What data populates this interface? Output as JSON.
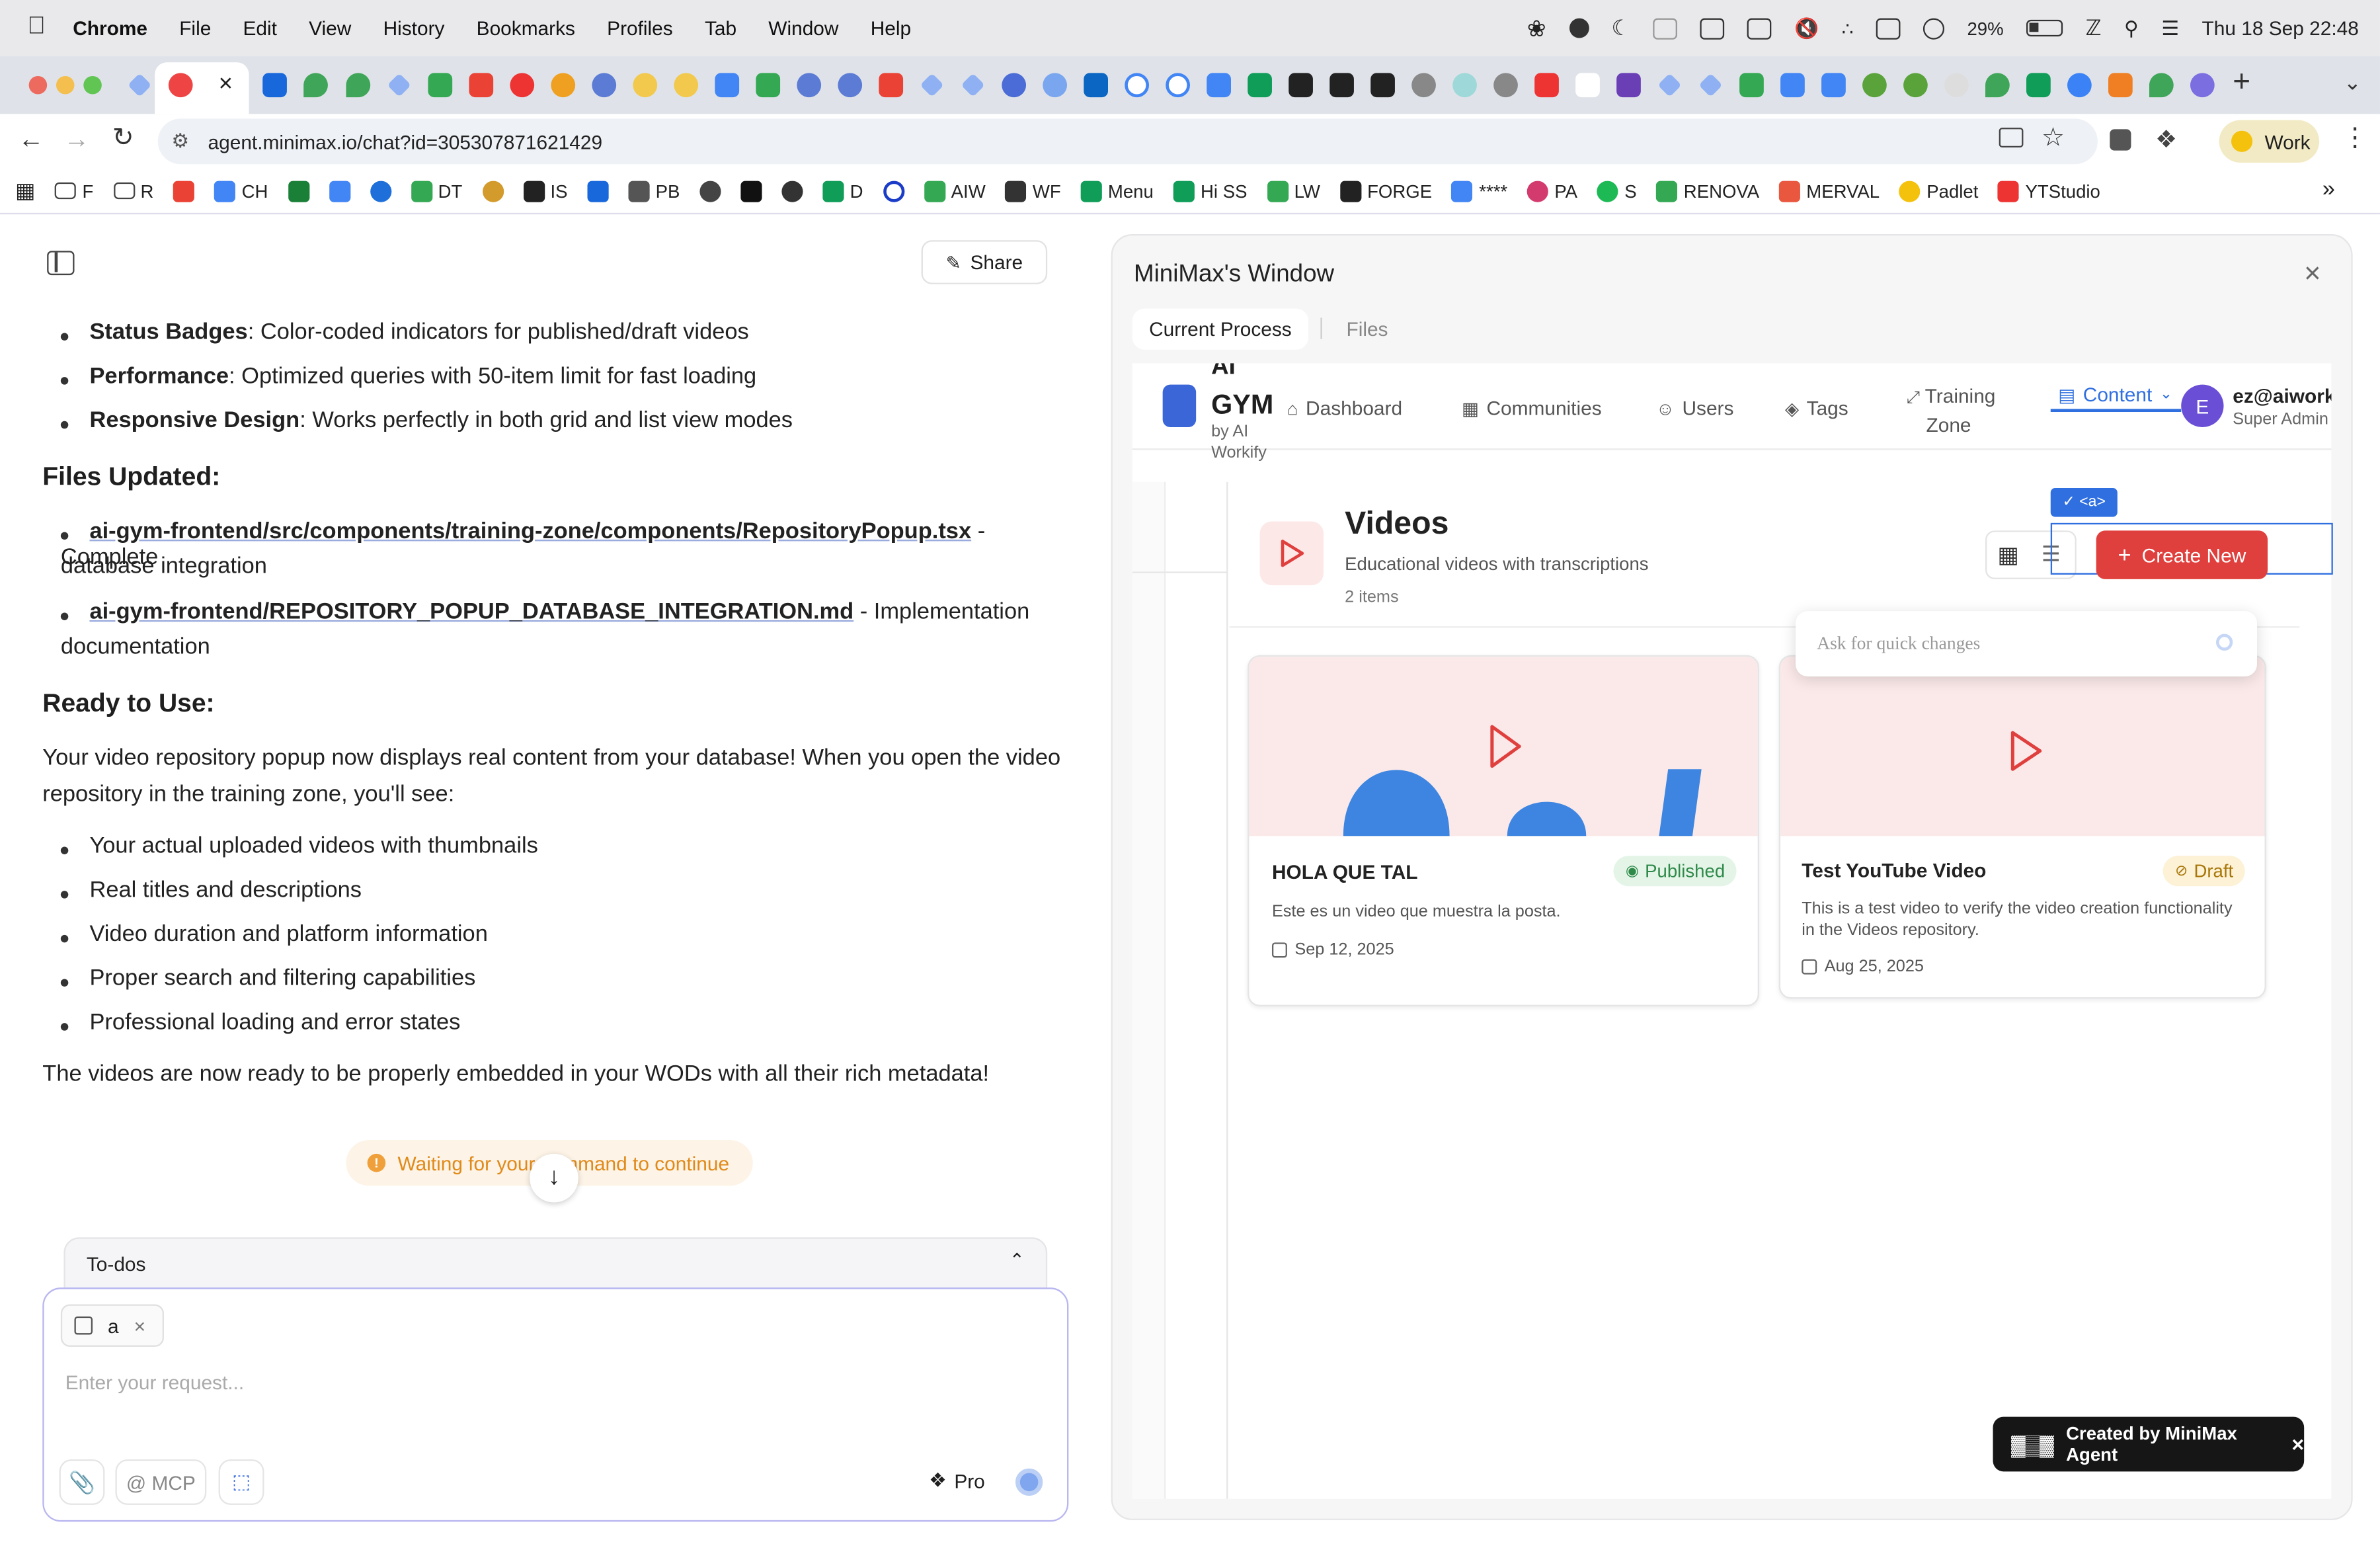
{
  "menubar": {
    "app": "Chrome",
    "items": [
      "File",
      "Edit",
      "View",
      "History",
      "Bookmarks",
      "Profiles",
      "Tab",
      "Window",
      "Help"
    ],
    "battery": "29%",
    "datetime": "Thu 18 Sep  22:48"
  },
  "browser": {
    "url": "agent.minimax.io/chat?id=305307871621429",
    "profile": "Work"
  },
  "bookmarks": [
    "F",
    "R",
    "CH",
    "DT",
    "IS",
    "PB",
    "D",
    "AIW",
    "WF",
    "Menu",
    "Hi SS",
    "LW",
    "FORGE",
    "****",
    "PA",
    "S",
    "RENOVA",
    "MERVAL",
    "Padlet",
    "YTStudio"
  ],
  "chat": {
    "share": "Share",
    "top_bullets": [
      {
        "b": "Status Badges",
        "t": ": Color-coded indicators for published/draft videos"
      },
      {
        "b": "Performance",
        "t": ": Optimized queries with 50-item limit for fast loading"
      },
      {
        "b": "Responsive Design",
        "t": ": Works perfectly in both grid and list view modes"
      }
    ],
    "files_heading": "Files Updated:",
    "file1": "ai-gym-frontend/src/components/training-zone/components/RepositoryPopup.tsx",
    "file1_desc": " - Complete",
    "file1_desc2": "database integration",
    "file2": "ai-gym-frontend/REPOSITORY_POPUP_DATABASE_INTEGRATION.md",
    "file2_desc": " - Implementation",
    "file2_desc2": "documentation",
    "ready_heading": "Ready to Use:",
    "para1": "Your video repository popup now displays real content from your database! When you open the video",
    "para2": "repository in the training zone, you'll see:",
    "list": [
      "Your actual uploaded videos with thumbnails",
      "Real titles and descriptions",
      "Video duration and platform information",
      "Proper search and filtering capabilities",
      "Professional loading and error states"
    ],
    "closing": "The videos are now ready to be properly embedded in your WODs with all their rich metadata!",
    "waiting": "Waiting for your command to continue",
    "todos": "To-dos",
    "chip": "a",
    "placeholder": "Enter your request...",
    "mcp": "@ MCP",
    "pro": "Pro"
  },
  "panel": {
    "title": "MiniMax's Window",
    "tab_current": "Current Process",
    "tab_files": "Files",
    "app": {
      "logo_top": "AI",
      "logo_main": "GYM",
      "logo_by1": "by AI",
      "logo_by2": "Workify",
      "nav": [
        "Dashboard",
        "Communities",
        "Users",
        "Tags",
        "Training",
        "Zone",
        "Content"
      ],
      "user_initial": "E",
      "user_email": "ez@aiworki",
      "user_role": "Super Admin",
      "tag": "✓ <a>",
      "page_title": "Videos",
      "page_sub": "Educational videos with transcriptions",
      "count": "2 items",
      "create": "Create New",
      "quick": "Ask for quick changes",
      "videos": [
        {
          "title": "HOLA QUE TAL",
          "status": "Published",
          "desc": "Este es un video que muestra la posta.",
          "date": "Sep 12, 2025"
        },
        {
          "title": "Test YouTube Video",
          "status": "Draft",
          "desc1": "This is a test video to verify the video creation functionality",
          "desc2": "in the Videos repository.",
          "date": "Aug 25, 2025"
        }
      ],
      "created_by": "Created by MiniMax Agent"
    }
  },
  "colors": {
    "accent_red": "#e0403d",
    "accent_blue": "#2f6fe0",
    "published_green": "#2f8a4a",
    "draft_amber": "#a8770a"
  }
}
